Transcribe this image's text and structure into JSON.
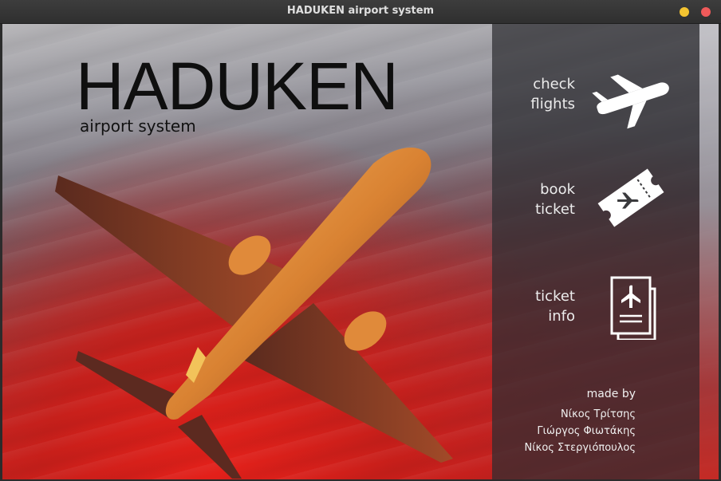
{
  "window": {
    "title": "HADUKEN airport system"
  },
  "brand": {
    "name": "HADUKEN",
    "subtitle": "airport system"
  },
  "menu": {
    "check_flights": {
      "label": "check\nflights",
      "icon": "airplane-icon"
    },
    "book_ticket": {
      "label": "book\nticket",
      "icon": "ticket-icon"
    },
    "ticket_info": {
      "label": "ticket\ninfo",
      "icon": "document-plane-icon"
    }
  },
  "credits": {
    "made_by": "made by",
    "authors": [
      "Νίκος Τρίτσης",
      "Γιώργος Φιωτάκης",
      "Νίκος Στεργιόπουλος"
    ]
  },
  "colors": {
    "panel": "#2d2d30",
    "minimize": "#f4c431",
    "close": "#ef5a5a",
    "text_light": "#ececec"
  }
}
